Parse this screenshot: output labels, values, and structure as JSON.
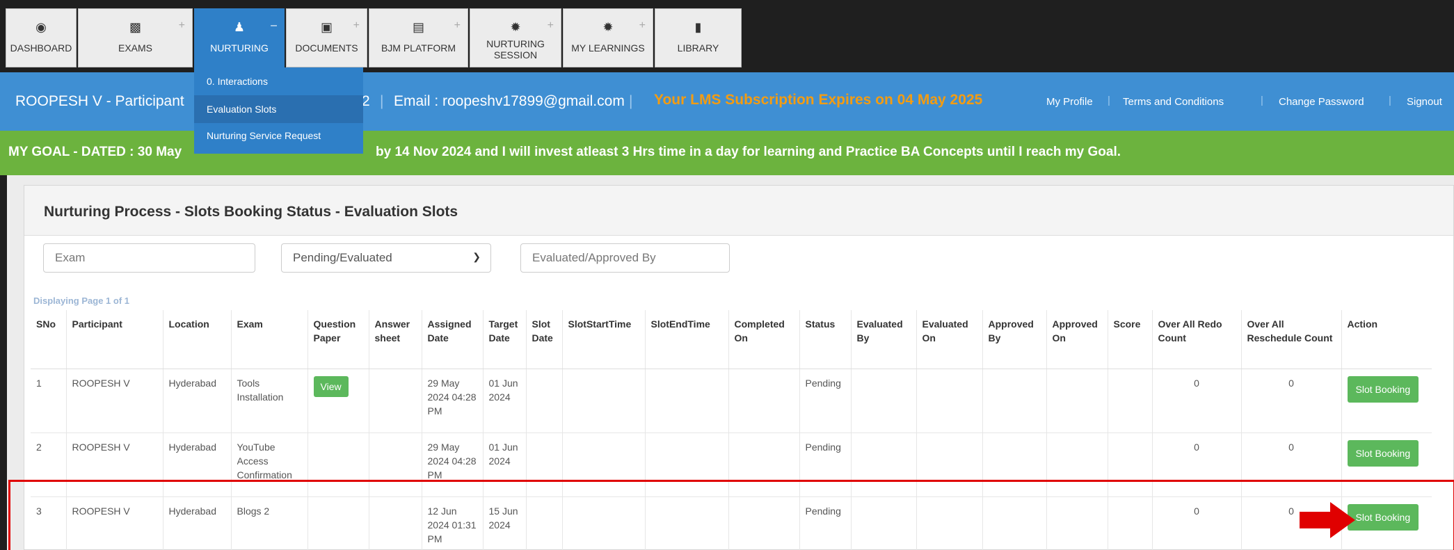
{
  "nav": {
    "tabs": [
      {
        "label": "DASHBOARD",
        "icon": "dashboard-icon",
        "plus": ""
      },
      {
        "label": "EXAMS",
        "icon": "bar-chart-icon",
        "plus": "+"
      },
      {
        "label": "NURTURING",
        "icon": "users-icon",
        "plus": "–"
      },
      {
        "label": "DOCUMENTS",
        "icon": "document-icon",
        "plus": "+"
      },
      {
        "label": "BJM PLATFORM",
        "icon": "server-icon",
        "plus": "+"
      },
      {
        "label": "NURTURING SESSION",
        "icon": "gear-icon",
        "plus": "+"
      },
      {
        "label": "MY LEARNINGS",
        "icon": "gear-icon",
        "plus": "+"
      },
      {
        "label": "LIBRARY",
        "icon": "book-icon",
        "plus": ""
      }
    ],
    "dropdown": [
      "0. Interactions",
      "Evaluation Slots",
      "Nurturing Service Request"
    ]
  },
  "info": {
    "name": "ROOPESH V - Participant",
    "num": "2",
    "email": "Email : roopeshv17899@gmail.com",
    "expiry": "Your LMS Subscription Expires on 04 May 2025",
    "links": [
      "My Profile",
      "Terms and Conditions",
      "Change Password",
      "Signout"
    ]
  },
  "goal": {
    "left": "MY GOAL - DATED : 30 May",
    "right": "by 14 Nov 2024 and I will invest atleast 3 Hrs time in a day for learning and Practice BA Concepts until I reach my Goal."
  },
  "panel": {
    "title": "Nurturing Process - Slots Booking Status - Evaluation Slots",
    "filters": {
      "exam_placeholder": "Exam",
      "status_value": "Pending/Evaluated",
      "by_placeholder": "Evaluated/Approved By"
    },
    "page_info": "Displaying Page 1 of 1"
  },
  "table": {
    "headers": [
      "SNo",
      "Participant",
      "Location",
      "Exam",
      "Question Paper",
      "Answer sheet",
      "Assigned Date",
      "Target Date",
      "Slot Date",
      "SlotStartTime",
      "SlotEndTime",
      "Completed On",
      "Status",
      "Evaluated By",
      "Evaluated On",
      "Approved By",
      "Approved On",
      "Score",
      "Over All Redo Count",
      "Over All Reschedule Count",
      "Action"
    ],
    "rows": [
      {
        "sno": "1",
        "participant": "ROOPESH V",
        "location": "Hyderabad",
        "exam": "Tools Installation",
        "qp": "View",
        "assigned": "29 May 2024 04:28 PM",
        "target": "01 Jun 2024",
        "status": "Pending",
        "redo": "0",
        "resched": "0",
        "action": "Slot Booking"
      },
      {
        "sno": "2",
        "participant": "ROOPESH V",
        "location": "Hyderabad",
        "exam": "YouTube Access Confirmation",
        "qp": "",
        "assigned": "29 May 2024 04:28 PM",
        "target": "01 Jun 2024",
        "status": "Pending",
        "redo": "0",
        "resched": "0",
        "action": "Slot Booking"
      },
      {
        "sno": "3",
        "participant": "ROOPESH V",
        "location": "Hyderabad",
        "exam": "Blogs 2",
        "qp": "",
        "assigned": "12 Jun 2024 01:31 PM",
        "target": "15 Jun 2024",
        "status": "Pending",
        "redo": "0",
        "resched": "0",
        "action": "Slot Booking"
      }
    ]
  },
  "colors": {
    "nav_active": "#2f80c8",
    "info_bar": "#3f8fd3",
    "goal_bar": "#6cb33e",
    "button": "#5cb85c",
    "highlight": "#e00000",
    "expiry_text": "#f39c12"
  }
}
